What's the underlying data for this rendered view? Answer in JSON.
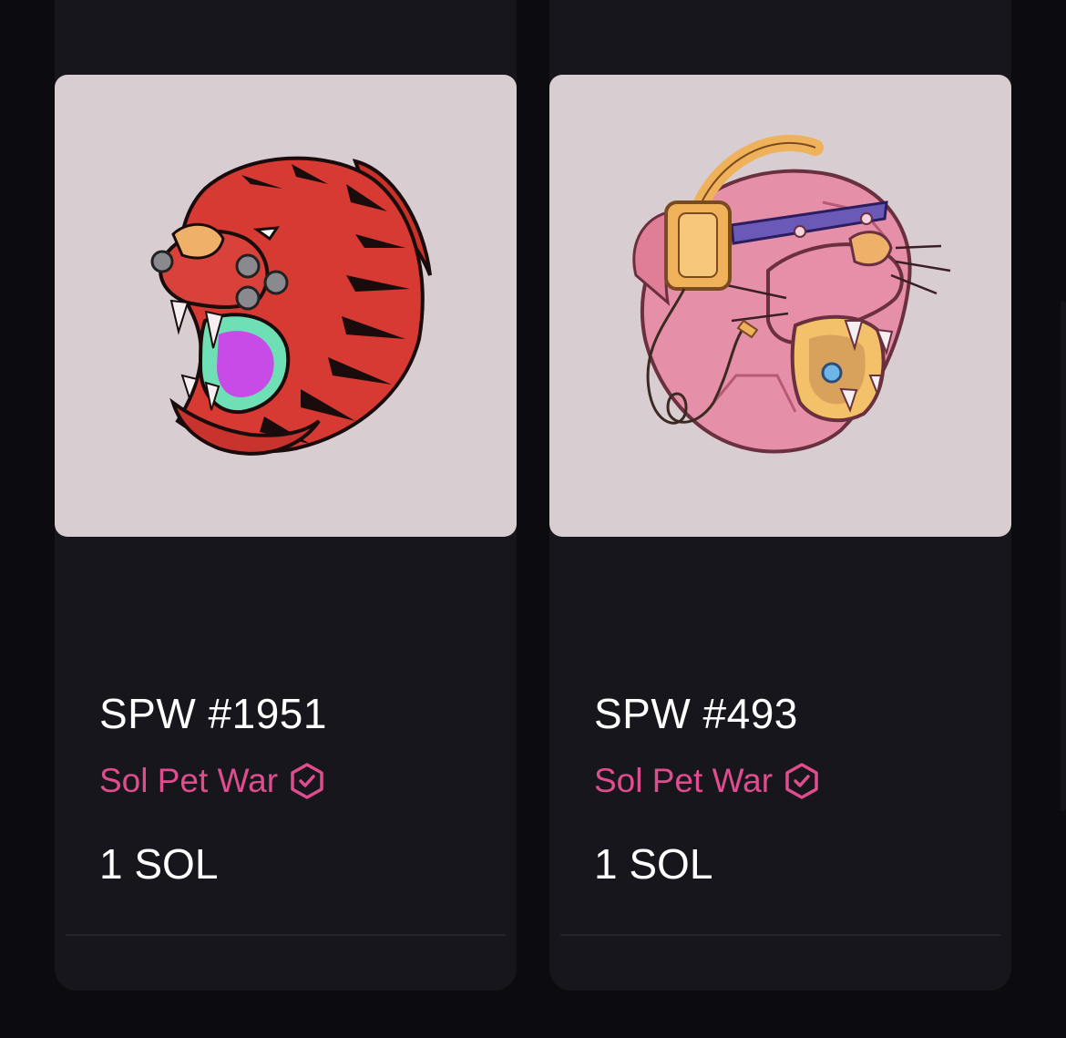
{
  "listings": [
    {
      "name": "SPW #1951",
      "collection": "Sol Pet War",
      "price": "1 SOL",
      "artwork_icon": "red-tiger-head-icon",
      "colors": {
        "background": "#d8ced2",
        "fur": "#d63a32",
        "mouth": "#c74be6"
      }
    },
    {
      "name": "SPW #493",
      "collection": "Sol Pet War",
      "price": "1 SOL",
      "artwork_icon": "pink-panther-headphones-icon",
      "colors": {
        "background": "#d8ced2",
        "fur": "#e58fa8",
        "headphones": "#efb15a"
      }
    }
  ],
  "theme": {
    "page_bg": "#0c0c10",
    "card_bg": "#16161c",
    "accent": "#e04d8e",
    "text": "#ffffff"
  }
}
